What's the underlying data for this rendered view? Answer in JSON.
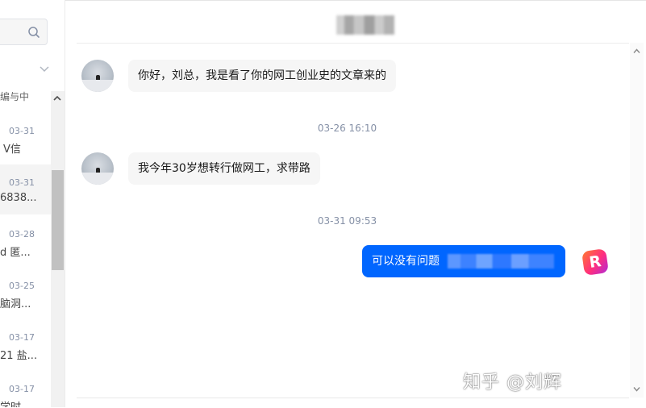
{
  "sidebar": {
    "search": {
      "placeholder": ""
    },
    "partial_top_text": "编与中",
    "conversations": [
      {
        "date": "03-31",
        "snippet": "V信"
      },
      {
        "date": "03-31",
        "snippet": "6838..."
      },
      {
        "date": "03-28",
        "snippet": "d 匿..."
      },
      {
        "date": "03-25",
        "snippet": "脑洞..."
      },
      {
        "date": "03-17",
        "snippet": "21 盐..."
      },
      {
        "date": "03-17",
        "snippet": "学时"
      }
    ]
  },
  "chat": {
    "title": "",
    "messages": [
      {
        "from": "other",
        "text": "你好，刘总，我是看了你的网工创业史的文章来的"
      },
      {
        "type": "time",
        "text": "03-26 16:10"
      },
      {
        "from": "other",
        "text": "我今年30岁想转行做网工，求带路"
      },
      {
        "type": "time",
        "text": "03-31 09:53"
      },
      {
        "from": "self",
        "text": "可以没有问题"
      }
    ],
    "self_avatar_letter": "R"
  },
  "watermark": "知乎 @刘辉",
  "colors": {
    "accent": "#0066ff",
    "bubble_other": "#f6f6f6",
    "time_text": "#8590a6"
  },
  "icons": {
    "search": "search-icon",
    "filter": "chevron-down-icon",
    "scroll_up": "chevron-up-icon",
    "scroll_down": "chevron-down-icon"
  }
}
